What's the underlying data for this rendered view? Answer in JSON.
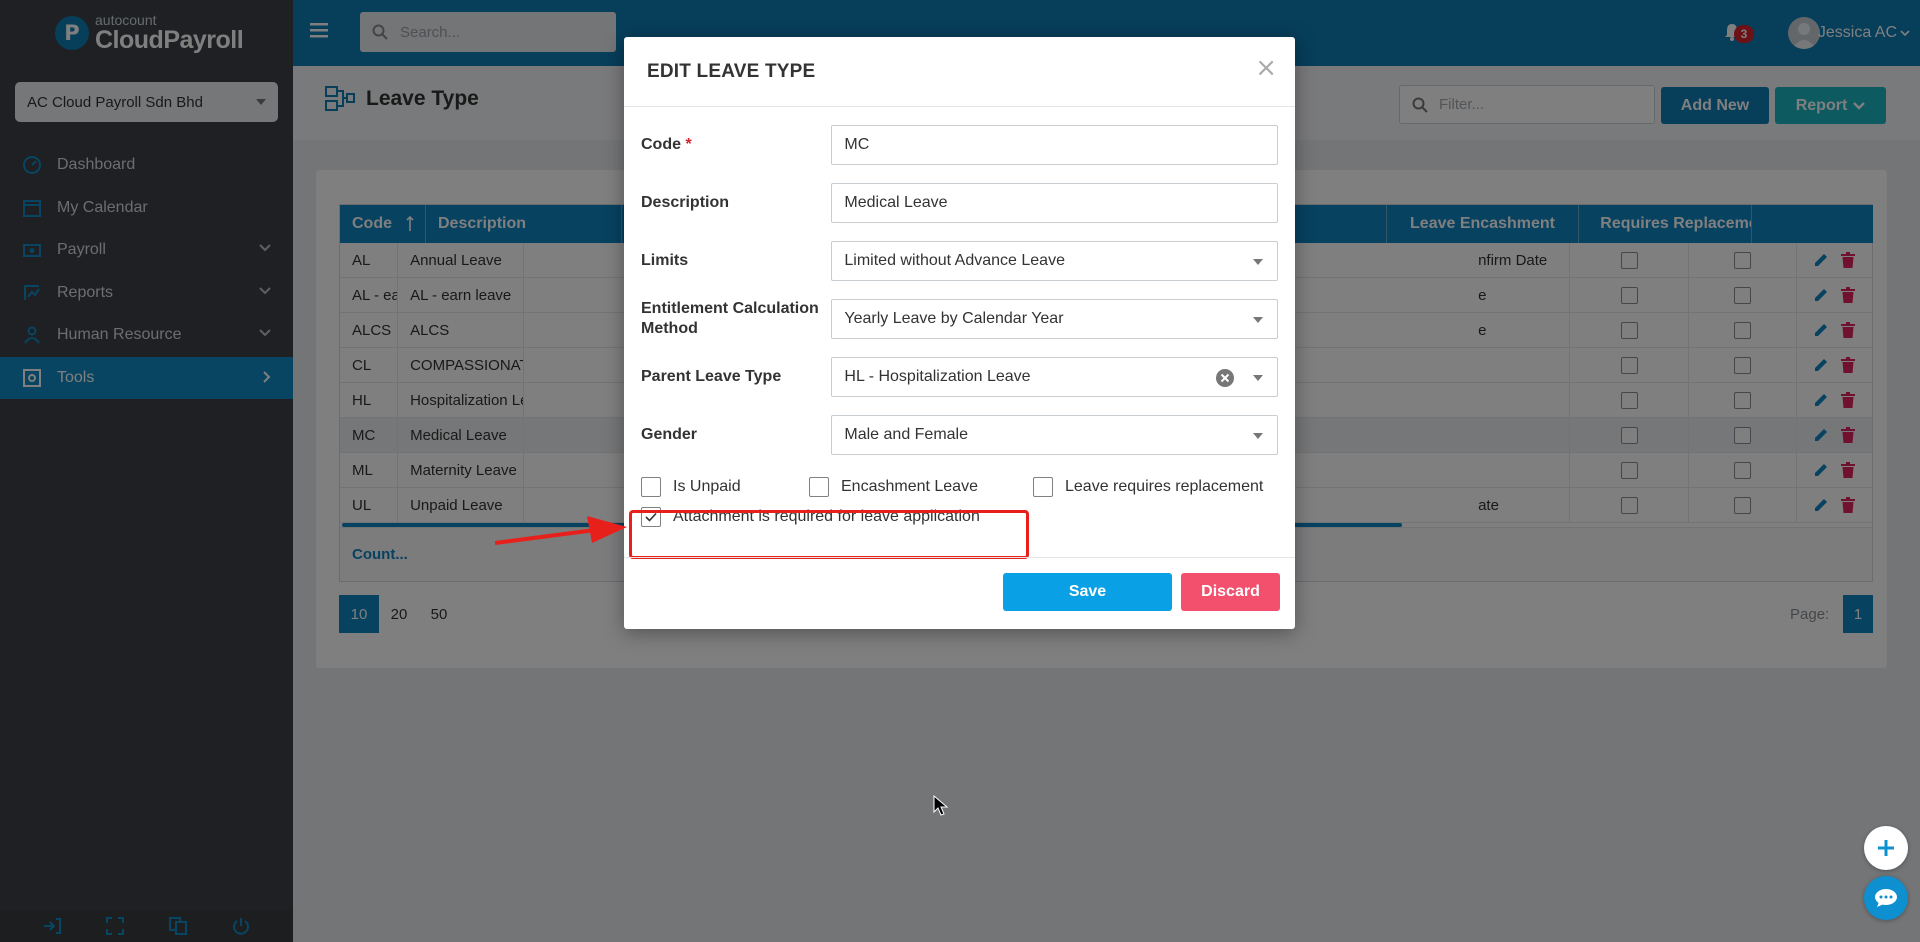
{
  "app": {
    "logo_superscript": "autocount",
    "logo_name": "CloudPayroll",
    "logo_letter": "P"
  },
  "sidebar": {
    "company": "AC Cloud Payroll Sdn Bhd",
    "items": [
      {
        "label": "Dashboard",
        "icon": "dashboard-icon"
      },
      {
        "label": "My Calendar",
        "icon": "calendar-icon"
      },
      {
        "label": "Payroll",
        "icon": "payroll-icon",
        "expand": "down"
      },
      {
        "label": "Reports",
        "icon": "reports-icon",
        "expand": "down"
      },
      {
        "label": "Human Resource",
        "icon": "human-resource-icon",
        "expand": "down"
      },
      {
        "label": "Tools",
        "icon": "tools-icon",
        "expand": "right",
        "active": true
      }
    ],
    "footer_icons": [
      "logout-icon",
      "fullscreen-icon",
      "language-icon",
      "power-icon"
    ]
  },
  "topbar": {
    "search_placeholder": "Search...",
    "notification_count": "3",
    "user_name": "Jessica AC"
  },
  "page": {
    "title": "Leave Type",
    "filter_placeholder": "Filter...",
    "add_new_label": "Add New",
    "report_label": "Report"
  },
  "table": {
    "headers": {
      "code": "Code",
      "description": "Description",
      "leave_encashment": "Leave Encashment",
      "requires_replacement": "Requires Replaceme"
    },
    "rows": [
      {
        "code": "AL",
        "description": "Annual Leave",
        "middle": "nfirm Date"
      },
      {
        "code": "AL - ea...",
        "description": "AL - earn leave",
        "middle": "e"
      },
      {
        "code": "ALCS",
        "description": "ALCS",
        "middle": "e"
      },
      {
        "code": "CL",
        "description": "COMPASSIONATE LEAVE",
        "middle": ""
      },
      {
        "code": "HL",
        "description": "Hospitalization Leave",
        "middle": ""
      },
      {
        "code": "MC",
        "description": "Medical Leave",
        "middle": "",
        "highlight": true
      },
      {
        "code": "ML",
        "description": "Maternity Leave",
        "middle": ""
      },
      {
        "code": "UL",
        "description": "Unpaid Leave",
        "middle": "ate"
      }
    ],
    "count_label": "Count..."
  },
  "pagination": {
    "sizes": [
      "10",
      "20",
      "50"
    ],
    "active_size": "10",
    "page_label": "Page:",
    "current_page": "1"
  },
  "modal": {
    "title": "EDIT LEAVE TYPE",
    "close": "×",
    "fields": {
      "code_label": "Code",
      "code_required": "*",
      "code_value": "MC",
      "description_label": "Description",
      "description_value": "Medical Leave",
      "limits_label": "Limits",
      "limits_value": "Limited without Advance Leave",
      "entitlement_label": "Entitlement Calculation Method",
      "entitlement_value": "Yearly Leave by Calendar Year",
      "parent_label": "Parent Leave Type",
      "parent_value": "HL - Hospitalization Leave",
      "gender_label": "Gender",
      "gender_value": "Male and Female"
    },
    "checkboxes": {
      "is_unpaid": "Is Unpaid",
      "encashment": "Encashment Leave",
      "requires_replacement": "Leave requires replacement",
      "attachment_required": "Attachment is required for leave application"
    },
    "save_label": "Save",
    "discard_label": "Discard"
  },
  "colors": {
    "brand": "#0e7db4",
    "sidebar": "#3d4146",
    "save": "#0aa0e6",
    "discard": "#f2506d",
    "annotation": "#e8201c"
  }
}
